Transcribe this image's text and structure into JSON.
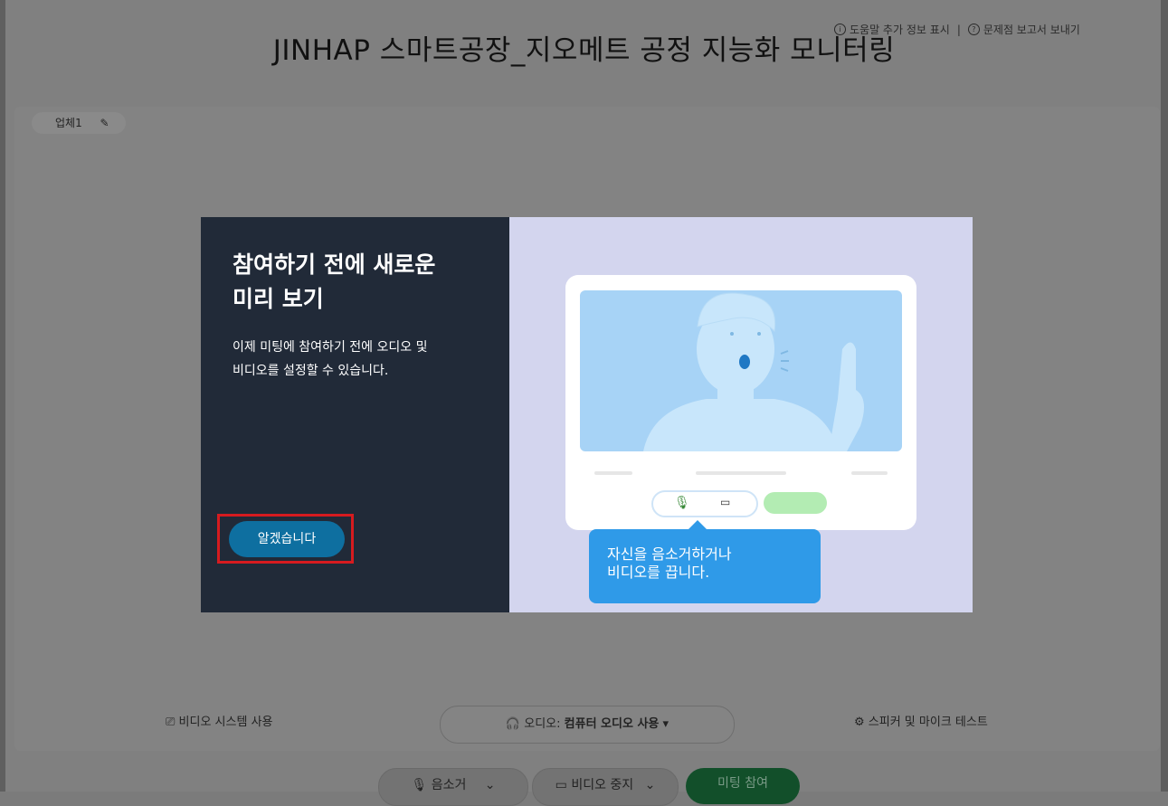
{
  "title": "JINHAP 스마트공장_지오메트 공정 지능화 모니터링",
  "header": {
    "help_label": "도움말 추가 정보 표시",
    "report_label": "문제점 보고서 보내기",
    "separator": "|"
  },
  "participant": {
    "name": "업체1"
  },
  "bottom_bar": {
    "video_system": "비디오 시스템 사용",
    "audio_prefix": "오디오:",
    "audio_value": "컴퓨터 오디오 사용",
    "speaker_test": "스피커 및 마이크 테스트"
  },
  "controls": {
    "mute": "음소거",
    "video_stop": "비디오 중지",
    "join": "미팅 참여"
  },
  "modal": {
    "title_line1": "참여하기 전에 새로운",
    "title_line2": "미리 보기",
    "desc_line1": "이제 미팅에 참여하기 전에 오디오 및",
    "desc_line2": "비디오를 설정할 수 있습니다.",
    "ok_button": "알겠습니다",
    "tooltip_line1": "자신을 음소거하거나",
    "tooltip_line2": "비디오를 끕니다."
  },
  "colors": {
    "modal_dark": "#212a38",
    "modal_light": "#d3d5ee",
    "primary_button": "#0e6fa0",
    "highlight": "#d61b1f",
    "tooltip": "#2f9ae8",
    "join_button": "#124f2a"
  }
}
